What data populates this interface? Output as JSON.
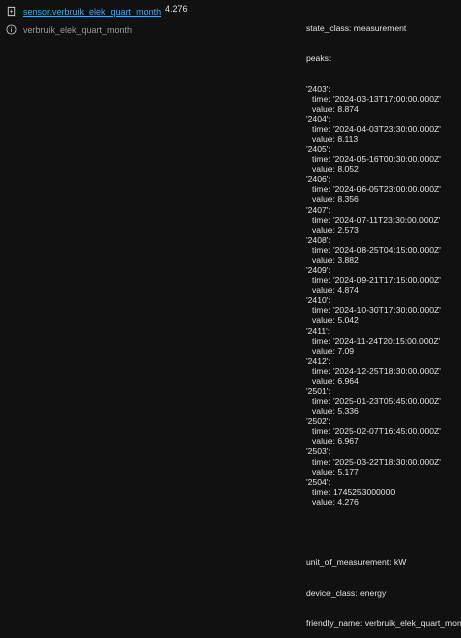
{
  "entity": {
    "entity_id": "sensor.verbruik_elek_quart_month",
    "friendly_name": "verbruik_elek_quart_month",
    "icons": [
      "lightning-icon",
      "info-icon"
    ]
  },
  "state": "4.276",
  "attributes": {
    "state_class_line": "state_class: measurement",
    "peaks_header": "peaks:",
    "peaks": [
      {
        "key": "'2403':",
        "time": "time: '2024-03-13T17:00:00.000Z'",
        "value": "value: 8.874"
      },
      {
        "key": "'2404':",
        "time": "time: '2024-04-03T23:30:00.000Z'",
        "value": "value: 8.113"
      },
      {
        "key": "'2405':",
        "time": "time: '2024-05-16T00:30:00.000Z'",
        "value": "value: 8.052"
      },
      {
        "key": "'2406':",
        "time": "time: '2024-06-05T23:00:00.000Z'",
        "value": "value: 8.356"
      },
      {
        "key": "'2407':",
        "time": "time: '2024-07-11T23:30:00.000Z'",
        "value": "value: 2.573"
      },
      {
        "key": "'2408':",
        "time": "time: '2024-08-25T04:15:00.000Z'",
        "value": "value: 3.882"
      },
      {
        "key": "'2409':",
        "time": "time: '2024-09-21T17:15:00.000Z'",
        "value": "value: 4.874"
      },
      {
        "key": "'2410':",
        "time": "time: '2024-10-30T17:30:00.000Z'",
        "value": "value: 5.042"
      },
      {
        "key": "'2411':",
        "time": "time: '2024-11-24T20:15:00.000Z'",
        "value": "value: 7.09"
      },
      {
        "key": "'2412':",
        "time": "time: '2024-12-25T18:30:00.000Z'",
        "value": "value: 6.964"
      },
      {
        "key": "'2501':",
        "time": "time: '2025-01-23T05:45:00.000Z'",
        "value": "value: 5.336"
      },
      {
        "key": "'2502':",
        "time": "time: '2025-02-07T16:45:00.000Z'",
        "value": "value: 6.967"
      },
      {
        "key": "'2503':",
        "time": "time: '2025-03-22T18:30:00.000Z'",
        "value": "value: 5.177"
      },
      {
        "key": "'2504':",
        "time": "time: 1745253000000",
        "value": "value: 4.276"
      }
    ],
    "unit_line": "unit_of_measurement: kW",
    "device_class_line": "device_class: energy",
    "friendly_name_line": "friendly_name: verbruik_elek_quart_month"
  }
}
